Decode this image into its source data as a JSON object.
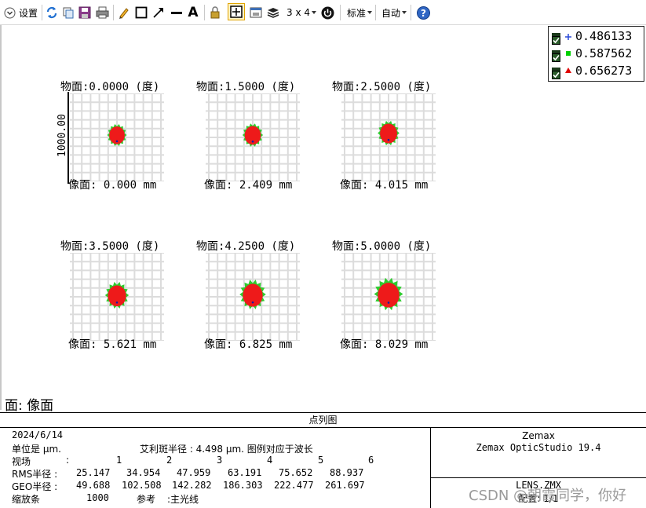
{
  "toolbar": {
    "settings_label": "设置",
    "layout_label": "3 x 4",
    "standard_label": "标准",
    "auto_label": "自动"
  },
  "legend": [
    {
      "symbol": "plus",
      "color": "#2a4ad8",
      "value": "0.486133"
    },
    {
      "symbol": "square",
      "color": "#00d000",
      "value": "0.587562"
    },
    {
      "symbol": "triangle",
      "color": "#e00000",
      "value": "0.656273"
    }
  ],
  "spots": [
    {
      "object": "物面:0.0000 (度)",
      "image": "像面: 0.000 mm",
      "size": 0.55,
      "blur": 0.15,
      "offset": 0.0
    },
    {
      "object": "物面:1.5000 (度)",
      "image": "像面: 2.409 mm",
      "size": 0.62,
      "blur": 0.2,
      "offset": 0.0
    },
    {
      "object": "物面:2.5000 (度)",
      "image": "像面: 4.015 mm",
      "size": 0.7,
      "blur": 0.25,
      "offset": -0.25
    },
    {
      "object": "物面:3.5000 (度)",
      "image": "像面: 5.621 mm",
      "size": 0.8,
      "blur": 0.4,
      "offset": 0.1
    },
    {
      "object": "物面:4.2500 (度)",
      "image": "像面: 6.825 mm",
      "size": 0.95,
      "blur": 0.55,
      "offset": 0.0
    },
    {
      "object": "物面:5.0000 (度)",
      "image": "像面: 8.029 mm",
      "size": 1.1,
      "blur": 0.7,
      "offset": -0.05
    }
  ],
  "scale_label": "1000.00",
  "surface_label": "面: 像面",
  "panel": {
    "title": "点列图",
    "date": "2024/6/14",
    "units_line": "单位是 μm.",
    "airy_line": "艾利斑半径 : 4.498 μm. 图例对应于波长",
    "field_label": "视场",
    "rms_label": "RMS半径 :",
    "geo_label": "GEO半径 :",
    "scale_label": "缩放条",
    "scale_value": "1000",
    "ref_label": "参考",
    "ref_value": ":主光线",
    "field_values": [
      "1",
      "2",
      "3",
      "4",
      "5",
      "6"
    ],
    "rms_values": [
      "25.147",
      "34.954",
      "47.959",
      "63.191",
      "75.652",
      "88.937"
    ],
    "geo_values": [
      "49.688",
      "102.508",
      "142.282",
      "186.303",
      "222.477",
      "261.697"
    ],
    "company": "Zemax",
    "product": "Zemax OpticStudio 19.4",
    "file": "LENS.ZMX",
    "config": "配置: 1/1"
  },
  "watermark": "CSDN @朝霞同学，你好"
}
